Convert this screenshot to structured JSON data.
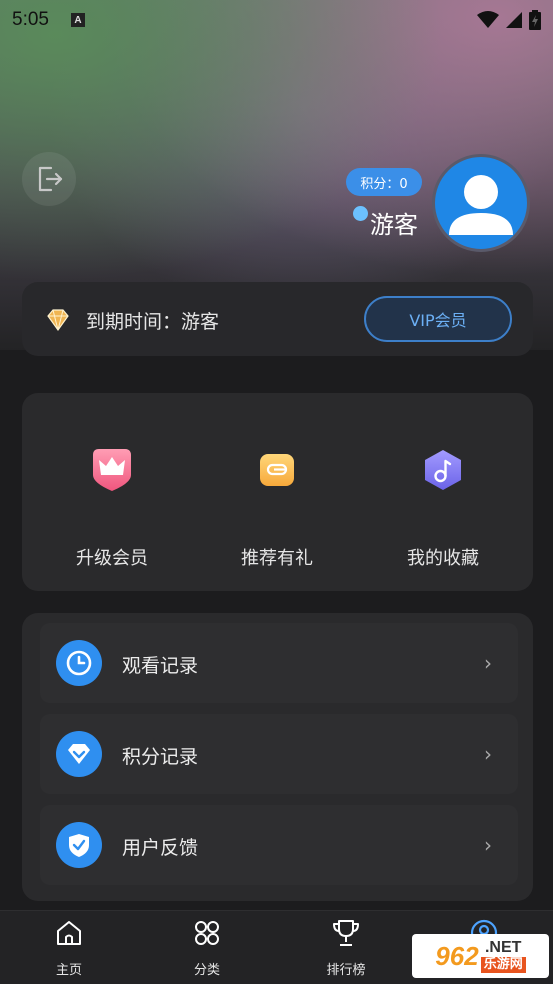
{
  "status_bar": {
    "time": "5:05",
    "notification_glyph": "A"
  },
  "profile": {
    "points_label": "积分：0",
    "username": "游客",
    "accent": "#1f87e6"
  },
  "vip": {
    "expiry_label": "到期时间：游客",
    "button_label": "VIP会员"
  },
  "quick_actions": [
    {
      "label": "升级会员",
      "icon": "crown-icon"
    },
    {
      "label": "推荐有礼",
      "icon": "wallet-icon"
    },
    {
      "label": "我的收藏",
      "icon": "music-note-icon"
    }
  ],
  "menu": [
    {
      "label": "观看记录",
      "icon": "clock-icon"
    },
    {
      "label": "积分记录",
      "icon": "points-diamond-icon"
    },
    {
      "label": "用户反馈",
      "icon": "shield-check-icon"
    }
  ],
  "tabs": [
    {
      "label": "主页",
      "icon": "home-icon"
    },
    {
      "label": "分类",
      "icon": "category-icon"
    },
    {
      "label": "排行榜",
      "icon": "trophy-icon"
    },
    {
      "label": "",
      "icon": "user-icon"
    }
  ],
  "watermark": {
    "text_962": "962",
    "text_net": ".NET",
    "text_cn": "乐游网"
  }
}
